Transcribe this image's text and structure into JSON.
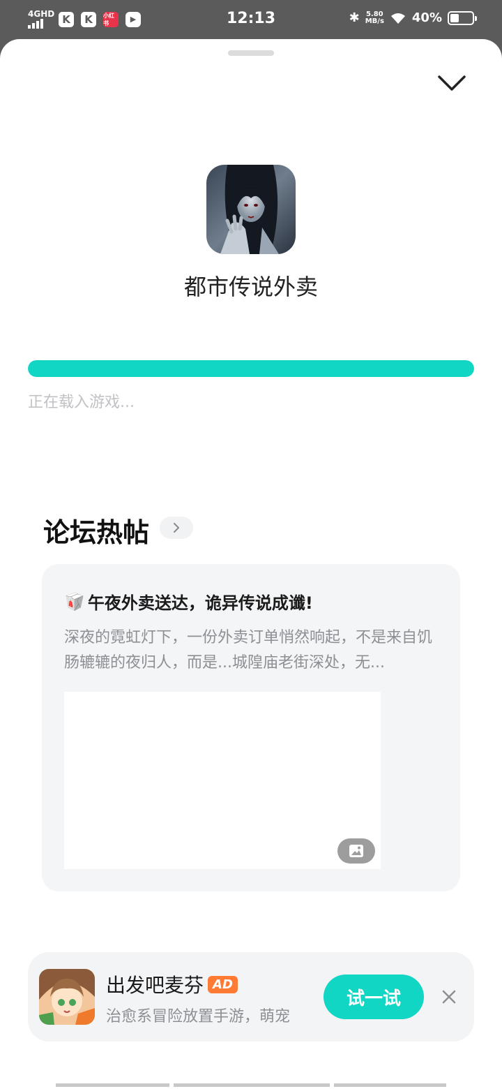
{
  "status_bar": {
    "network": "4GHD",
    "time": "12:13",
    "net_speed_value": "5.80",
    "net_speed_unit": "MB/s",
    "battery_percent": "40%",
    "battery_level": 0.4,
    "app_icons": [
      "K",
      "K",
      "小红书",
      "▶"
    ]
  },
  "game": {
    "title": "都市传说外卖",
    "loading_text": "正在载入游戏...",
    "progress": 1.0
  },
  "forum": {
    "heading": "论坛热帖",
    "post": {
      "emoji": "🥡",
      "title": "午夜外卖送达，诡异传说成谶!",
      "excerpt": "深夜的霓虹灯下，一份外卖订单悄然响起，不是来自饥肠辘辘的夜归人，而是...城隍庙老街深处，无..."
    }
  },
  "ad": {
    "name": "出发吧麦芬",
    "badge": "AD",
    "description": "治愈系冒险放置手游，萌宠",
    "cta": "试一试"
  },
  "colors": {
    "accent": "#11d6c4",
    "ad_badge": "#ff7a33",
    "card_bg": "#f4f5f7"
  }
}
